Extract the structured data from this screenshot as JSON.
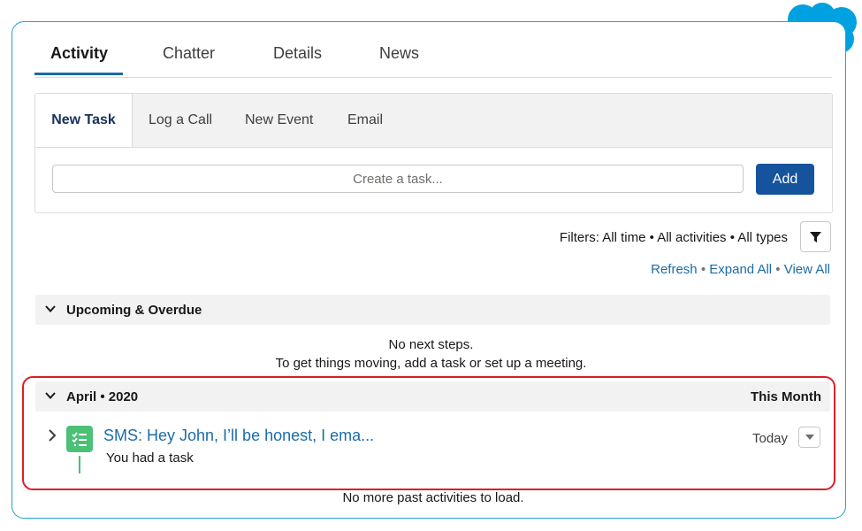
{
  "tabs": [
    "Activity",
    "Chatter",
    "Details",
    "News"
  ],
  "publisher": {
    "tabs": [
      "New Task",
      "Log a Call",
      "New Event",
      "Email"
    ],
    "task_placeholder": "Create a task...",
    "add_label": "Add"
  },
  "filters": {
    "text": "Filters: All time • All activities • All types",
    "refresh": "Refresh",
    "expand_all": "Expand All",
    "view_all": "View All",
    "separator": " • "
  },
  "upcoming": {
    "title": "Upcoming & Overdue",
    "empty_line1": "No next steps.",
    "empty_line2": "To get things moving, add a task or set up a meeting."
  },
  "month_group": {
    "title": "April • 2020",
    "right_label": "This Month",
    "item": {
      "title": "SMS: Hey John, I’ll be honest, I ema...",
      "subtitle": "You had a task",
      "date": "Today"
    }
  },
  "footer": {
    "no_more": "No more past activities to load."
  },
  "colors": {
    "accent": "#1b6ca8",
    "brand_button": "#16539d",
    "task_icon": "#4bc076",
    "highlight": "#d91f2a",
    "card_border": "#1f9fd6",
    "cloud": "#00a1e0"
  },
  "icons": [
    "salesforce-cloud-logo",
    "filter-icon",
    "chevron-down-icon",
    "chevron-right-icon",
    "task-icon",
    "dropdown-menu-icon"
  ]
}
